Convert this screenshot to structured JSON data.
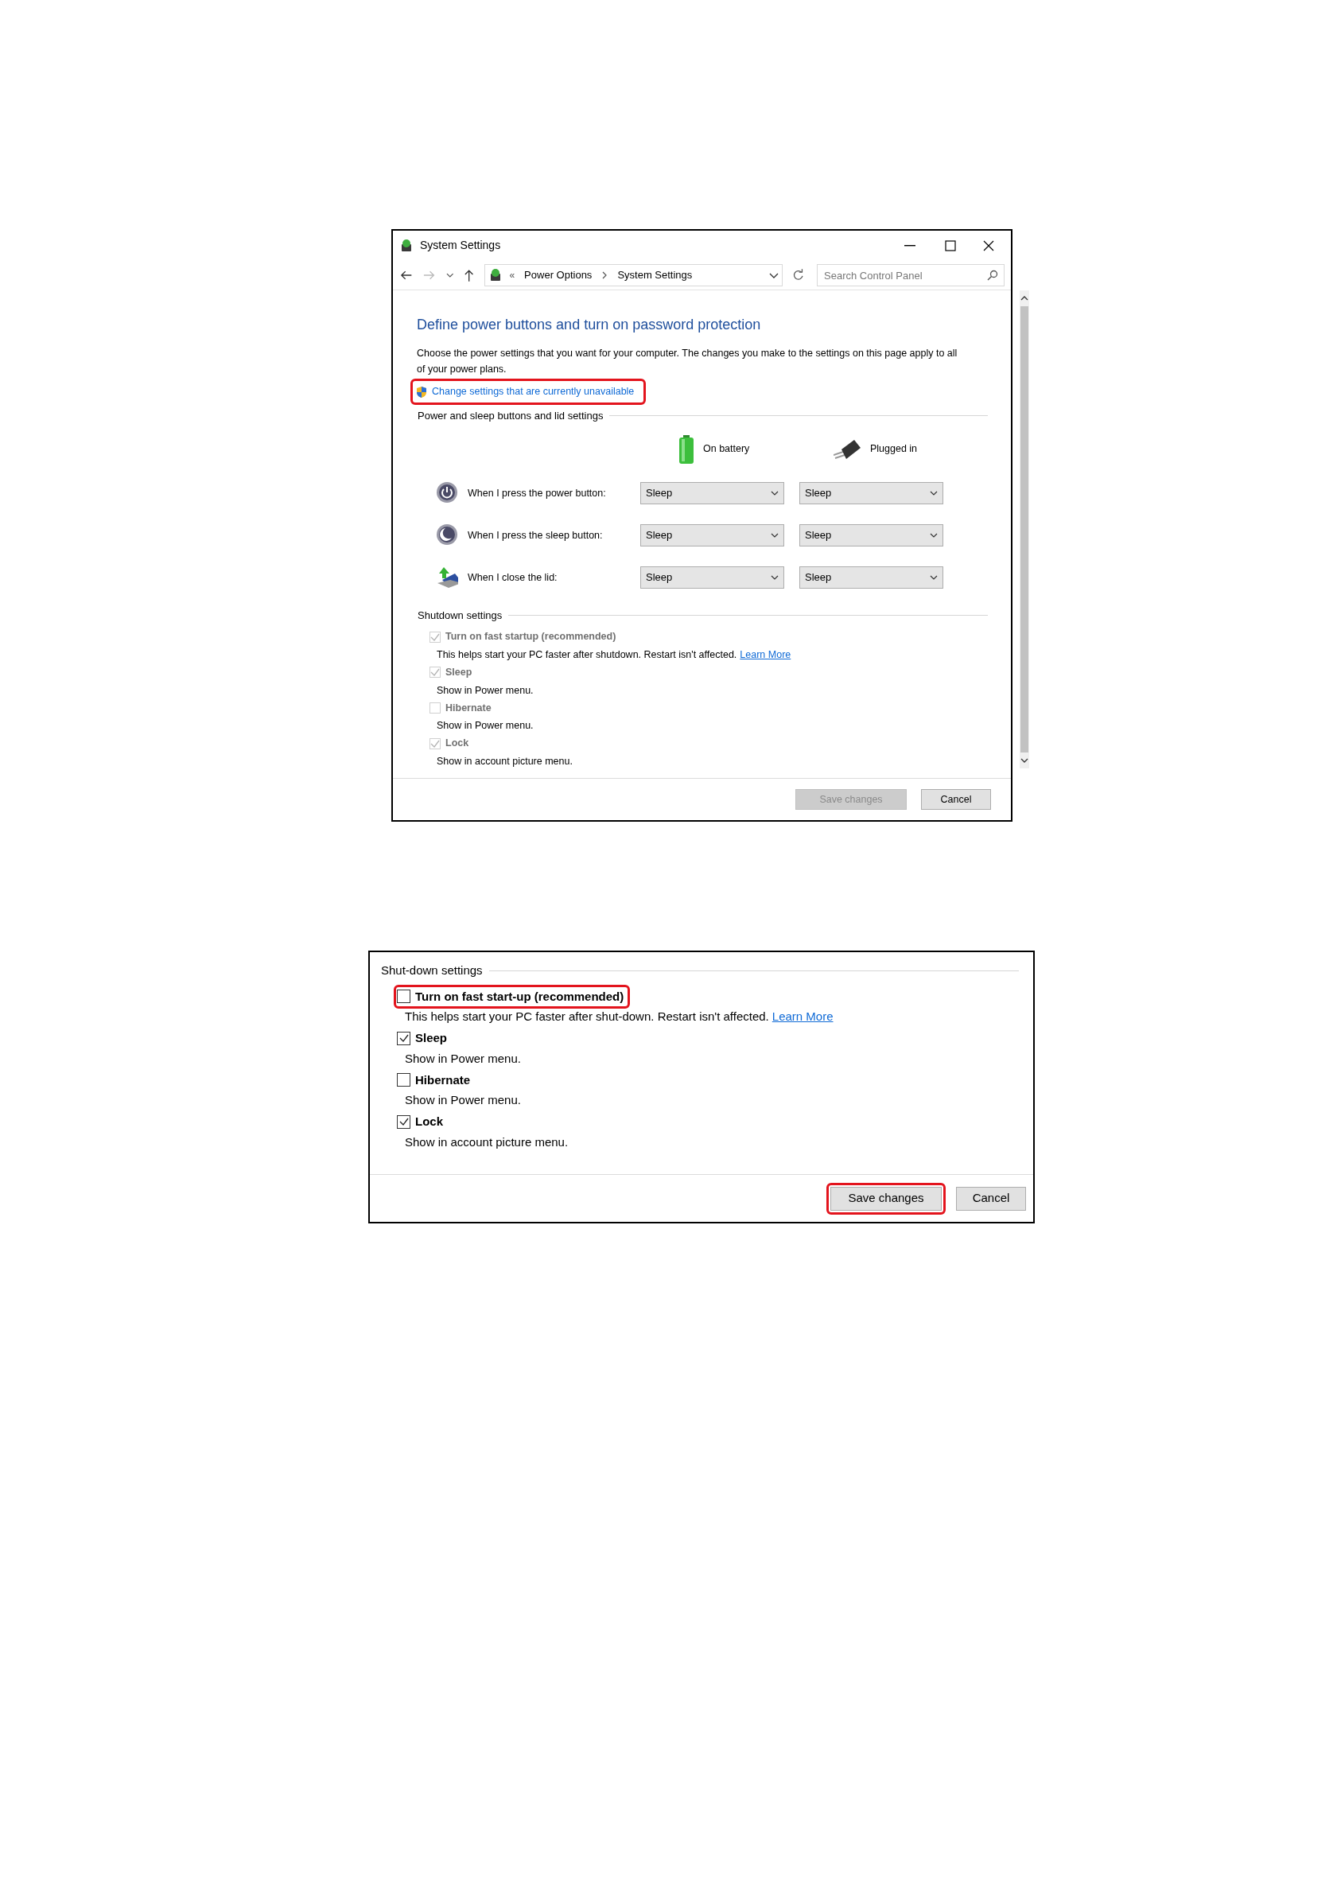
{
  "window": {
    "title": "System Settings",
    "breadcrumb_overflow": "«",
    "breadcrumb": [
      "Power Options",
      "System Settings"
    ],
    "search": {
      "placeholder": "Search Control Panel"
    },
    "heading": "Define power buttons and turn on password protection",
    "intro": "Choose the power settings that you want for your computer. The changes you make to the settings on this page apply to all of your power plans.",
    "admin_link": {
      "label": "Change settings that are currently unavailable",
      "highlighted": true
    },
    "buttons_section": {
      "title": "Power and sleep buttons and lid settings",
      "columns": [
        {
          "kind": "battery",
          "label": "On battery"
        },
        {
          "kind": "plug",
          "label": "Plugged in"
        }
      ],
      "rows": [
        {
          "kind": "power",
          "label": "When I press the power button:",
          "values": [
            "Sleep",
            "Sleep"
          ]
        },
        {
          "kind": "sleep",
          "label": "When I press the sleep button:",
          "values": [
            "Sleep",
            "Sleep"
          ]
        },
        {
          "kind": "lid",
          "label": "When I close the lid:",
          "values": [
            "Sleep",
            "Sleep"
          ]
        }
      ]
    },
    "shutdown": {
      "title": "Shutdown settings",
      "items": [
        {
          "label": "Turn on fast startup (recommended)",
          "checked": true,
          "disabled": true,
          "highlighted": false,
          "description": "This helps start your PC faster after shutdown. Restart isn't affected.",
          "link": "Learn More"
        },
        {
          "label": "Sleep",
          "checked": true,
          "disabled": true,
          "highlighted": false,
          "description": "Show in Power menu."
        },
        {
          "label": "Hibernate",
          "checked": false,
          "disabled": true,
          "highlighted": false,
          "description": "Show in Power menu."
        },
        {
          "label": "Lock",
          "checked": true,
          "disabled": true,
          "highlighted": false,
          "description": "Show in account picture menu."
        }
      ]
    },
    "footer_buttons": [
      {
        "label": "Save changes",
        "disabled": true,
        "highlighted": false
      },
      {
        "label": "Cancel",
        "disabled": false,
        "highlighted": false
      }
    ]
  },
  "closeup": {
    "shutdown": {
      "title": "Shut-down settings",
      "items": [
        {
          "label": "Turn on fast start-up (recommended)",
          "checked": false,
          "disabled": false,
          "highlighted": true,
          "description": "This helps start your PC faster after shut-down. Restart isn't affected.",
          "link": "Learn More"
        },
        {
          "label": "Sleep",
          "checked": true,
          "disabled": false,
          "highlighted": false,
          "description": "Show in Power menu."
        },
        {
          "label": "Hibernate",
          "checked": false,
          "disabled": false,
          "highlighted": false,
          "description": "Show in Power menu."
        },
        {
          "label": "Lock",
          "checked": true,
          "disabled": false,
          "highlighted": false,
          "description": "Show in account picture menu."
        }
      ]
    },
    "footer_buttons": [
      {
        "label": "Save changes",
        "disabled": false,
        "highlighted": true
      },
      {
        "label": "Cancel",
        "disabled": false,
        "highlighted": false
      }
    ]
  }
}
